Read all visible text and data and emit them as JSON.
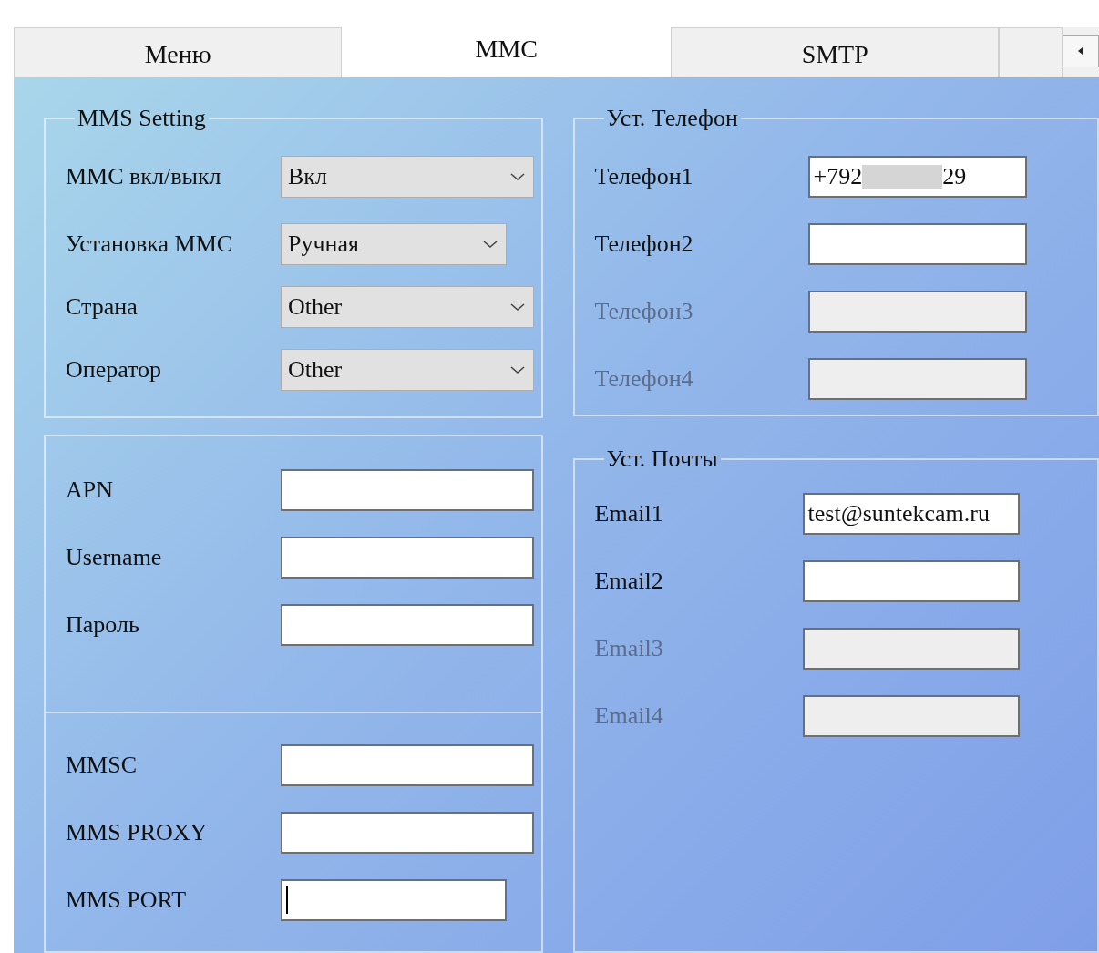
{
  "tabs": [
    {
      "label": "Меню",
      "selected": false
    },
    {
      "label": "ММС",
      "selected": true
    },
    {
      "label": "SMTP",
      "selected": false
    }
  ],
  "left_groups": [
    {
      "title": "MMS Setting",
      "fields": [
        {
          "label": "ММС вкл/выкл",
          "kind": "select",
          "value": "Вкл",
          "disabled": false
        },
        {
          "label": "Установка ММС",
          "kind": "select",
          "value": "Ручная",
          "disabled": false
        },
        {
          "label": "Страна",
          "kind": "select",
          "value": "Other",
          "disabled": false
        },
        {
          "label": "Оператор",
          "kind": "select",
          "value": "Other",
          "disabled": false
        }
      ]
    },
    {
      "fields": [
        {
          "label": "APN",
          "kind": "text",
          "disabled": false
        },
        {
          "label": "Username",
          "kind": "text",
          "disabled": false
        },
        {
          "label": "Пароль",
          "kind": "text",
          "disabled": false
        }
      ]
    },
    {
      "fields": [
        {
          "label": "MMSC",
          "kind": "text",
          "disabled": false
        },
        {
          "label": "MMS PROXY",
          "kind": "text",
          "disabled": false
        },
        {
          "label": "MMS PORT",
          "kind": "text",
          "disabled": false,
          "focused": true
        }
      ]
    }
  ],
  "right_groups": [
    {
      "title": "Уст. Телефон",
      "fields": [
        {
          "label": "Телефон1",
          "kind": "text",
          "value": "+792",
          "value_tail": "29",
          "disabled": false
        },
        {
          "label": "Телефон2",
          "kind": "text",
          "disabled": false
        },
        {
          "label": "Телефон3",
          "kind": "text",
          "disabled": true
        },
        {
          "label": "Телефон4",
          "kind": "text",
          "disabled": true
        }
      ]
    },
    {
      "title": "Уст. Почты",
      "fields": [
        {
          "label": "Email1",
          "kind": "text",
          "value": "test@suntekcam.ru",
          "disabled": false
        },
        {
          "label": "Email2",
          "kind": "text",
          "disabled": false
        },
        {
          "label": "Email3",
          "kind": "text",
          "disabled": true
        },
        {
          "label": "Email4",
          "kind": "text",
          "disabled": true
        }
      ]
    }
  ]
}
